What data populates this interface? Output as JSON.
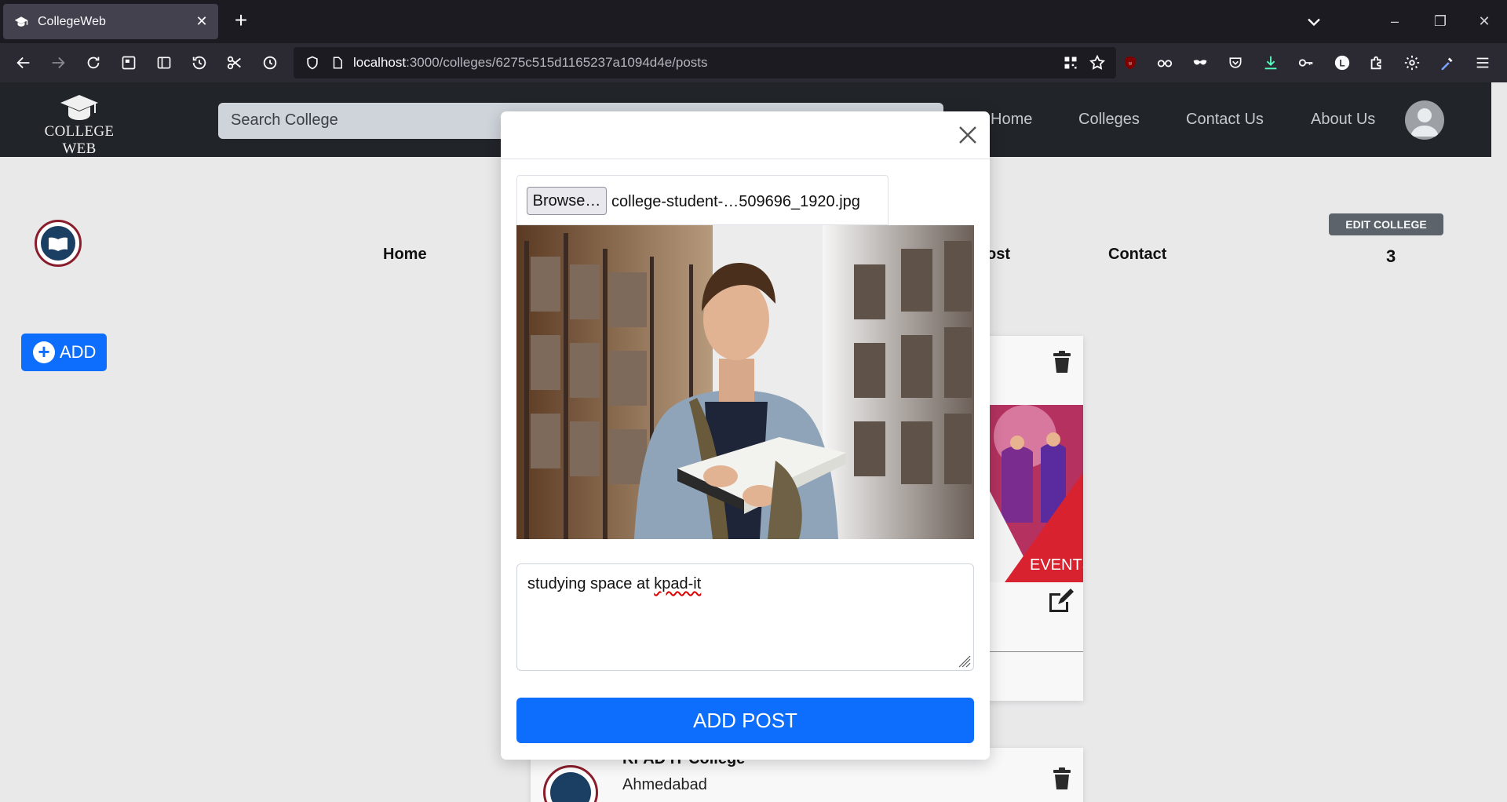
{
  "browser": {
    "tab_title": "CollegeWeb",
    "url_host": "localhost",
    "url_path": ":3000/colleges/6275c515d1165237a1094d4e/posts"
  },
  "site": {
    "logo_text": "COLLEGE WEB",
    "search_placeholder": "Search College",
    "menu": [
      "Home",
      "Colleges",
      "Contact Us",
      "About Us"
    ]
  },
  "college_page": {
    "subnav": [
      "Home",
      "ost",
      "Contact"
    ],
    "edit_label": "EDIT COLLEGE",
    "count": "3",
    "add_label": "ADD",
    "event_label": "EVENTS",
    "college_name": "KPAD IT College",
    "college_city": "Ahmedabad"
  },
  "modal": {
    "browse_label": "Browse…",
    "file_name": "college-student-…509696_1920.jpg",
    "caption_prefix": "studying space at ",
    "caption_word": "kpad-it",
    "submit_label": "ADD POST"
  },
  "colors": {
    "primary": "#0d6efd",
    "header_bg": "#212529",
    "edit_bg": "#5c636a",
    "college_ring": "#8a1d2b",
    "college_inner": "#1b3e63"
  }
}
